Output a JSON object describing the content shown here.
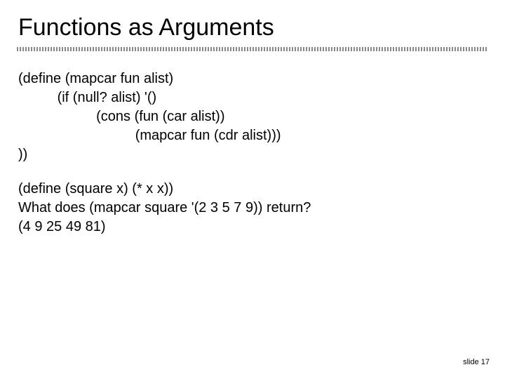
{
  "title": "Functions as Arguments",
  "code_block": {
    "line1": "(define (mapcar fun alist)",
    "line2": "          (if (null? alist) '()",
    "line3": "                    (cons (fun (car alist))",
    "line4": "                              (mapcar fun (cdr alist)))",
    "line5": "))"
  },
  "example_block": {
    "line1": "(define (square x) (* x x))",
    "line2": "What does (mapcar square '(2 3 5 7 9)) return?",
    "line3": "(4 9 25 49 81)"
  },
  "footer": "slide 17"
}
